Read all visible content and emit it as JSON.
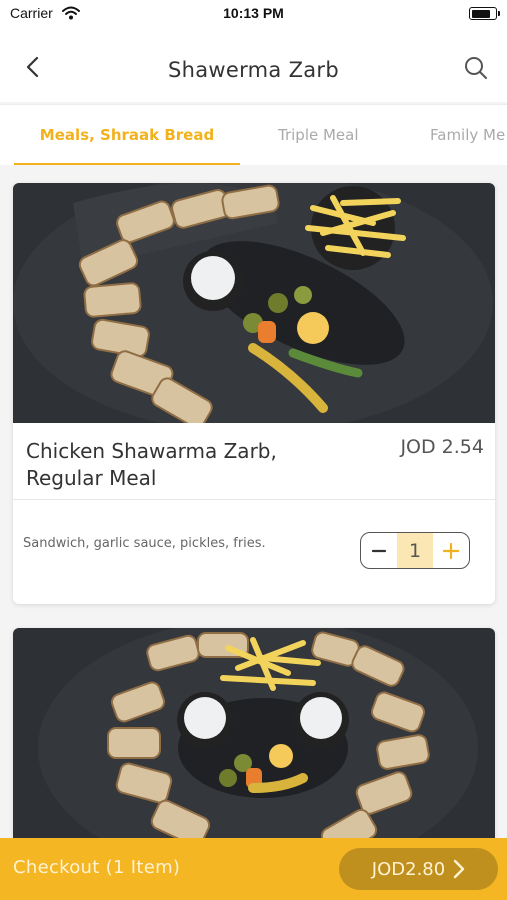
{
  "status_bar": {
    "carrier": "Carrier",
    "time": "10:13 PM",
    "battery_level": 0.85
  },
  "nav": {
    "title": "Shawerma Zarb",
    "back_icon": "chevron-left-icon",
    "search_icon": "search-icon"
  },
  "tabs": [
    {
      "label": "Meals, Shraak Bread",
      "active": true
    },
    {
      "label": "Triple Meal",
      "active": false
    },
    {
      "label": "Family Me",
      "active": false
    }
  ],
  "items": [
    {
      "name_line1": "Chicken Shawarma Zarb,",
      "name_line2": "Regular Meal",
      "price": "JOD 2.54",
      "description": "Sandwich, garlic sauce, pickles, fries.",
      "quantity": "1"
    }
  ],
  "checkout": {
    "label": "Checkout (1 Item)",
    "total": "JOD2.80",
    "arrow_icon": "chevron-right-icon"
  },
  "colors": {
    "accent": "#f2b21d",
    "checkout_bar": "#f4b623",
    "checkout_pill": "#c0901f",
    "qty_bg": "#fbe7b3"
  }
}
